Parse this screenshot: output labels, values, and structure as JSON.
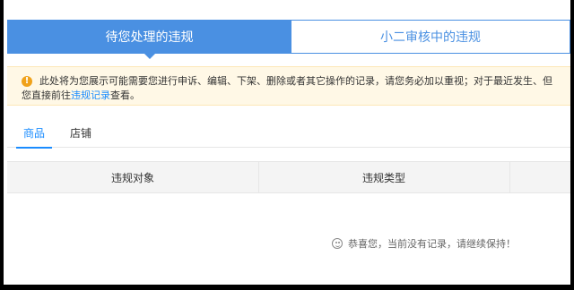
{
  "tabs": {
    "active": "待您处理的违规",
    "inactive": "小二审核中的违规"
  },
  "notice": {
    "icon": "warning-icon",
    "line1": "此处将为您展示可能需要您进行申诉、编辑、下架、删除或者其它操作的记录，请您务必加以重视；对于最近发生、但",
    "line2_before": "您直接前往",
    "line2_link": "违规记录",
    "line2_after": "查看。"
  },
  "subtabs": [
    "商品",
    "店铺"
  ],
  "table": {
    "headers": [
      "违规对象",
      "违规类型",
      ""
    ]
  },
  "empty": {
    "icon": "smile-icon",
    "text": "恭喜您，当前没有记录，请继续保持！"
  },
  "colors": {
    "primary": "#4a90e2",
    "link": "#1a8cff",
    "notice_bg": "#fff8e6",
    "warning": "#f0a21b"
  }
}
